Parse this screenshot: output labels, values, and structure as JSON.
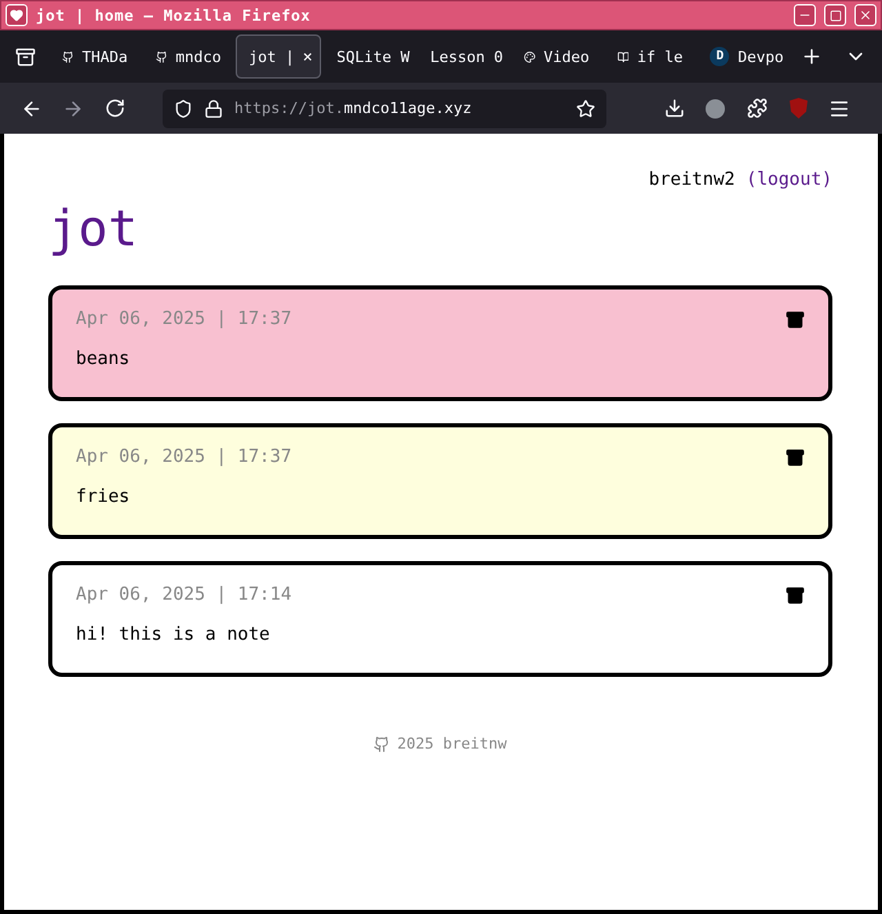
{
  "window": {
    "title": "jot | home — Mozilla Firefox"
  },
  "tabs": [
    {
      "label": "THADa",
      "kind": "github",
      "selected": false
    },
    {
      "label": "mndco",
      "kind": "github",
      "selected": false
    },
    {
      "label": "jot |",
      "kind": "plain",
      "selected": true,
      "close": "×"
    },
    {
      "label": "SQLite W",
      "kind": "plain",
      "selected": false
    },
    {
      "label": "Lesson 0",
      "kind": "plain",
      "selected": false
    },
    {
      "label": "Video",
      "kind": "palette",
      "selected": false
    },
    {
      "label": "if le",
      "kind": "book",
      "selected": false
    },
    {
      "label": "Devpo",
      "kind": "letter",
      "letter": "D",
      "selected": false
    }
  ],
  "address": {
    "prefix": "https://jot.",
    "domain": "mndco11age.xyz"
  },
  "page": {
    "user": "breitnw2",
    "logout": "(logout)",
    "title": "jot",
    "notes": [
      {
        "date": "Apr 06, 2025 | 17:37",
        "text": "beans",
        "color": "#f8c0d0"
      },
      {
        "date": "Apr 06, 2025 | 17:37",
        "text": "fries",
        "color": "#fefedd"
      },
      {
        "date": "Apr 06, 2025 | 17:14",
        "text": "hi! this is a note",
        "color": "#ffffff"
      }
    ],
    "footer": "2025 breitnw"
  }
}
